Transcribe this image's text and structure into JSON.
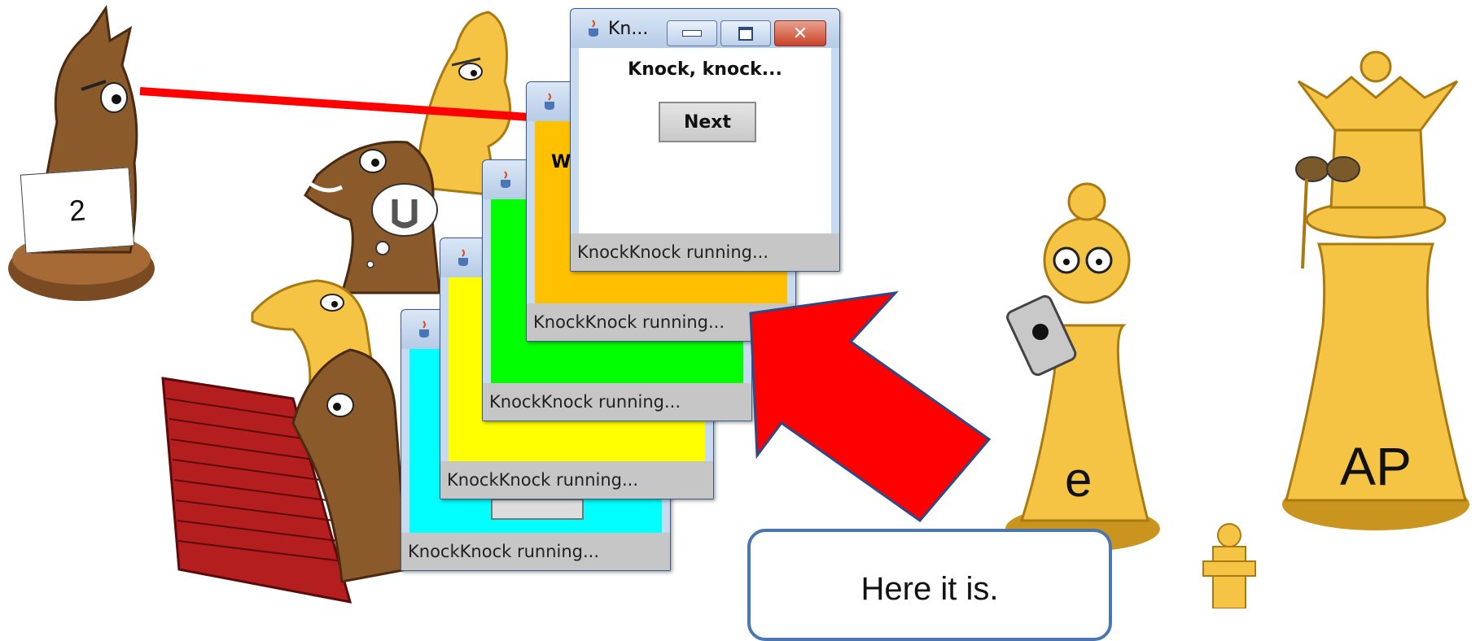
{
  "windows": [
    {
      "status": "KnockKnock running..."
    },
    {
      "status": "KnockKnock running..."
    },
    {
      "status": "KnockKnock running..."
    },
    {
      "status": "KnockKnock running...",
      "partial_label": "W"
    },
    {
      "title": "Kn...",
      "message": "Knock, knock...",
      "button_label": "Next",
      "status": "KnockKnock running..."
    }
  ],
  "colors": {
    "window_cyan": "#00ffff",
    "window_yellow": "#ffff00",
    "window_green": "#00ff00",
    "window_orange": "#ffc000",
    "arrow_red": "#ff0000"
  },
  "labels": {
    "knight_sign": "2",
    "pawn_letter": "e",
    "queen_letters": "AP",
    "speech": "Here it is."
  }
}
